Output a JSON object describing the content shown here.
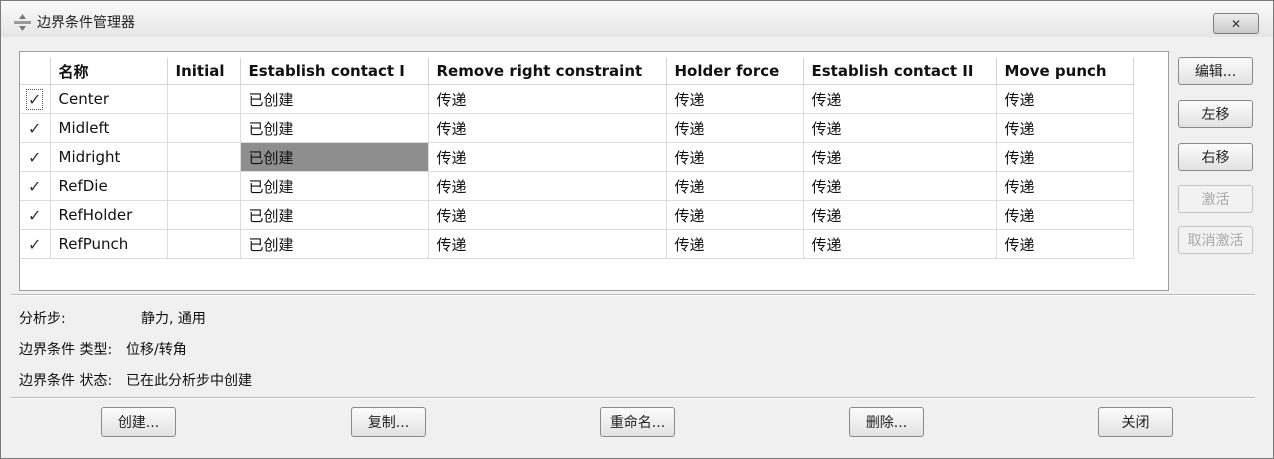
{
  "window": {
    "title": "边界条件管理器",
    "close_label": "✕"
  },
  "table": {
    "headers": [
      "名称",
      "Initial",
      "Establish contact I",
      "Remove right constraint",
      "Holder force",
      "Establish contact II",
      "Move punch"
    ],
    "rows": [
      {
        "checked": true,
        "name": "Center",
        "initial": "",
        "est1": "已创建",
        "remove_right": "传递",
        "holder": "传递",
        "est2": "传递",
        "move": "传递"
      },
      {
        "checked": true,
        "name": "Midleft",
        "initial": "",
        "est1": "已创建",
        "remove_right": "传递",
        "holder": "传递",
        "est2": "传递",
        "move": "传递"
      },
      {
        "checked": true,
        "name": "Midright",
        "initial": "",
        "est1": "已创建",
        "remove_right": "传递",
        "holder": "传递",
        "est2": "传递",
        "move": "传递"
      },
      {
        "checked": true,
        "name": "RefDie",
        "initial": "",
        "est1": "已创建",
        "remove_right": "传递",
        "holder": "传递",
        "est2": "传递",
        "move": "传递"
      },
      {
        "checked": true,
        "name": "RefHolder",
        "initial": "",
        "est1": "已创建",
        "remove_right": "传递",
        "holder": "传递",
        "est2": "传递",
        "move": "传递"
      },
      {
        "checked": true,
        "name": "RefPunch",
        "initial": "",
        "est1": "已创建",
        "remove_right": "传递",
        "holder": "传递",
        "est2": "传递",
        "move": "传递"
      }
    ],
    "check_glyph": "✓"
  },
  "side_buttons": {
    "edit": "编辑...",
    "move_left": "左移",
    "move_right": "右移",
    "activate": "激活",
    "deactivate": "取消激活"
  },
  "info": {
    "step_label": "分析步:",
    "step_value": "静力, 通用",
    "type_label": "边界条件 类型:",
    "type_value": "位移/转角",
    "status_label": "边界条件 状态:",
    "status_value": "已在此分析步中创建"
  },
  "bottom_buttons": {
    "create": "创建...",
    "copy": "复制...",
    "rename": "重命名...",
    "delete": "删除...",
    "close": "关闭"
  }
}
